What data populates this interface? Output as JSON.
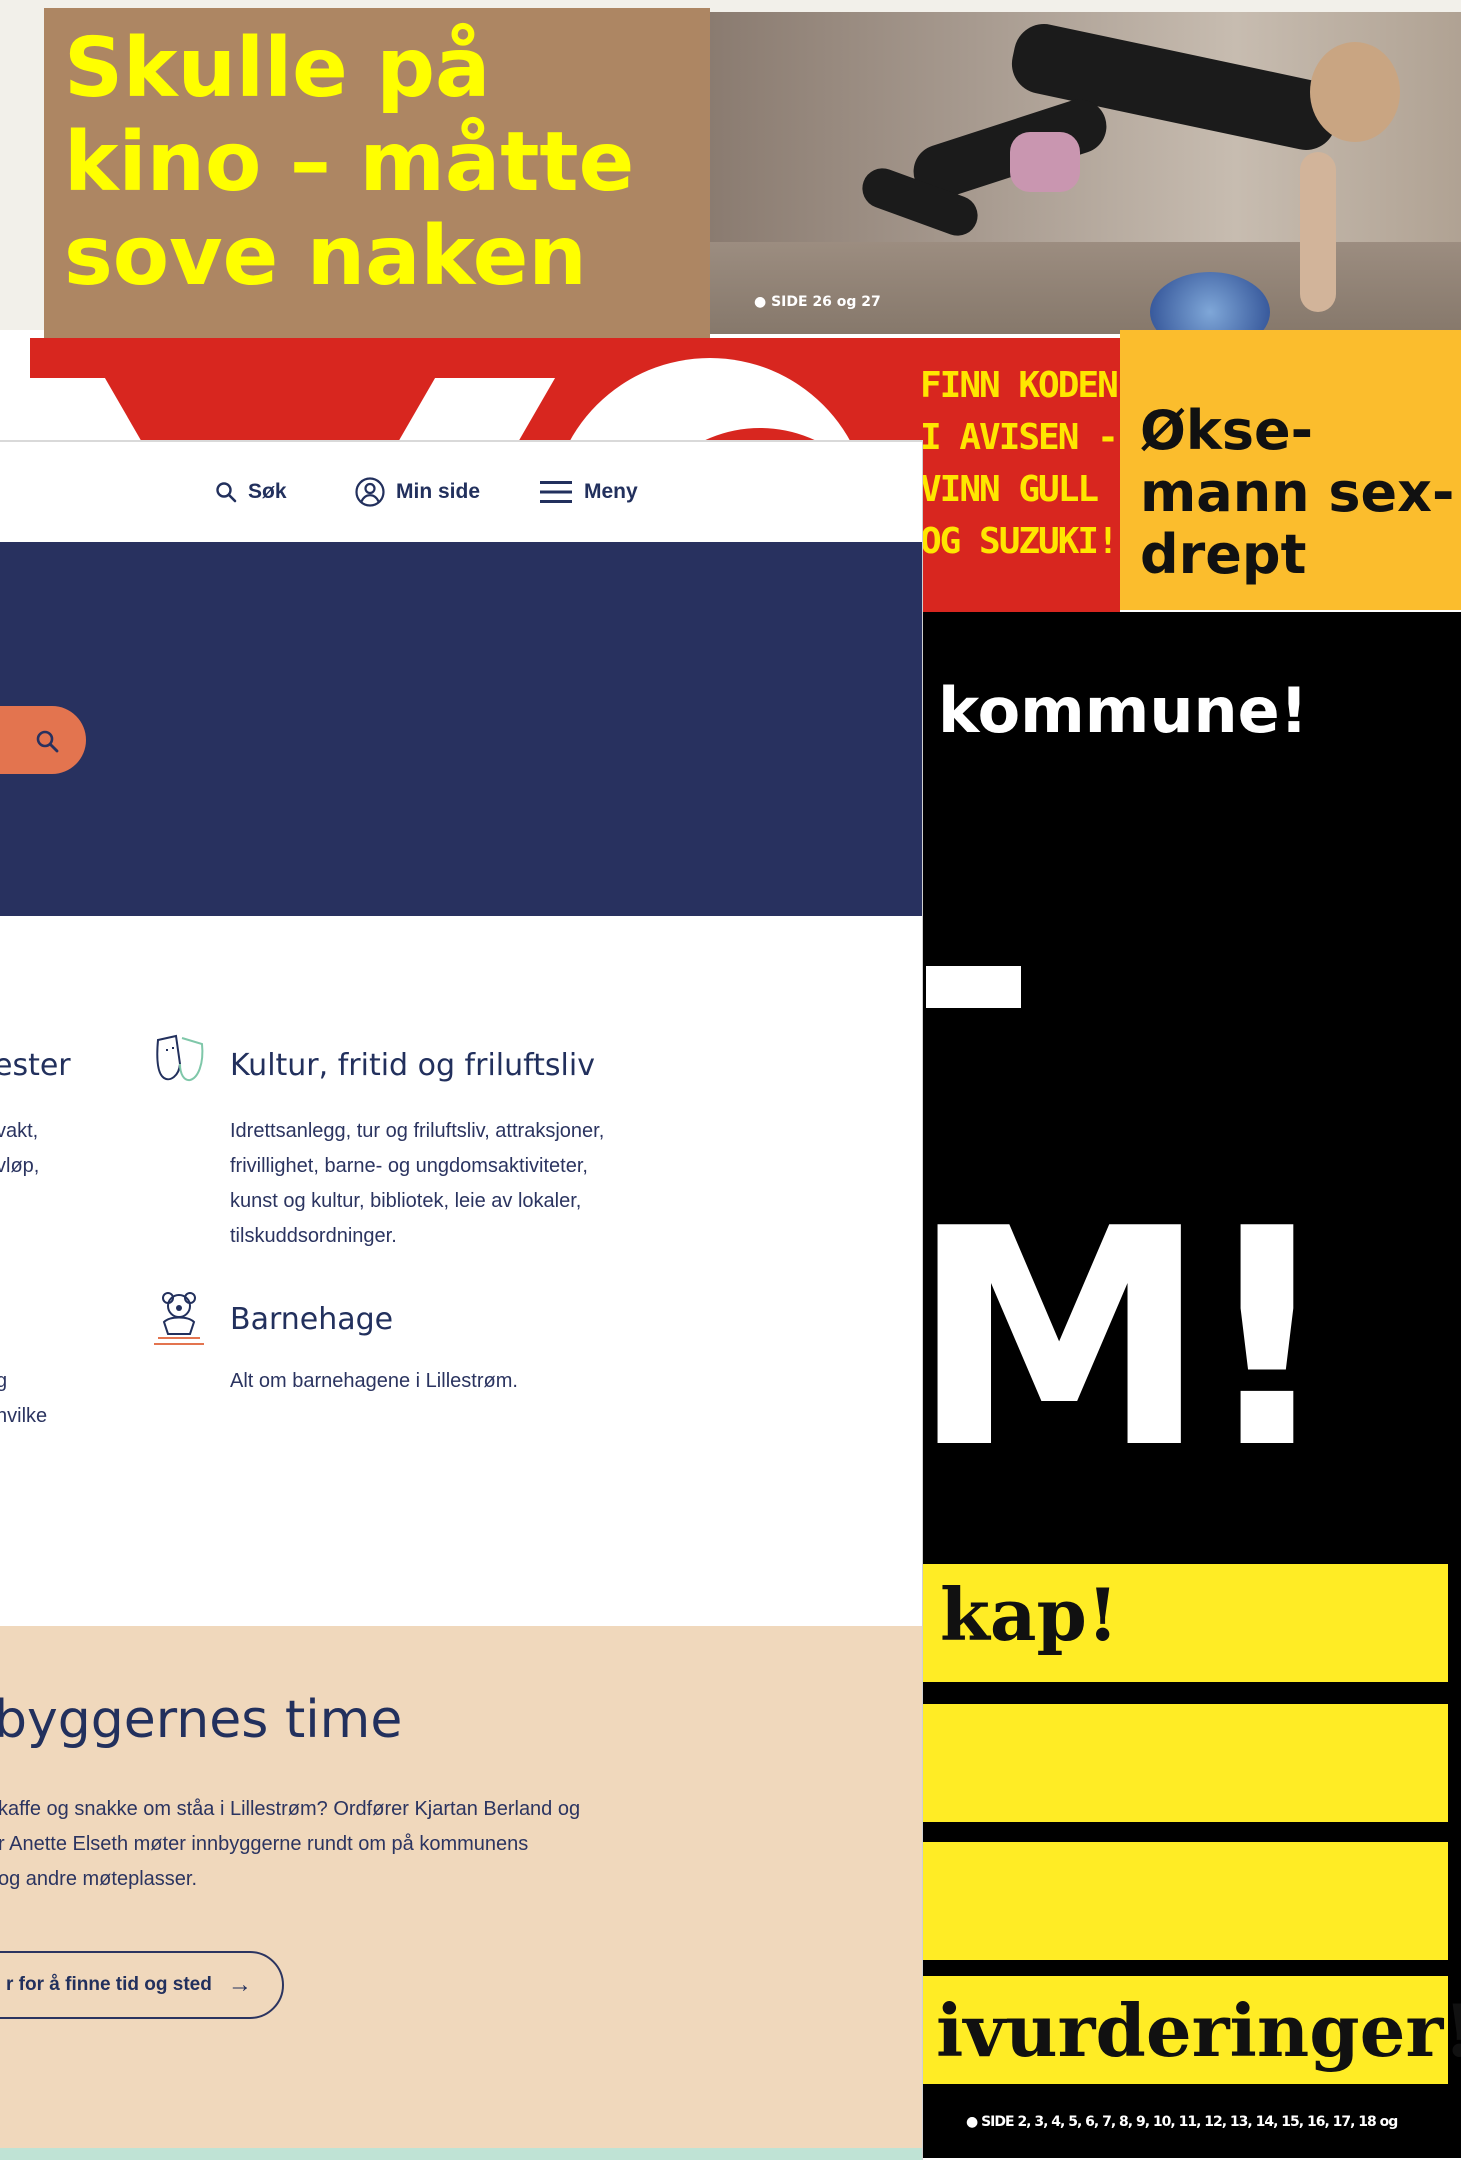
{
  "newspaper": {
    "skulle_lines": [
      "Skulle på",
      "kino – måtte",
      "sove naken"
    ],
    "photo_caption": "● SIDE 26 og 27",
    "finn_lines": [
      "FINN KODEN",
      "I AVISEN -",
      "VINN GULL",
      "OG SUZUKI!"
    ],
    "okse_lines": [
      "Økse-",
      "mann sex-",
      "drept"
    ],
    "kommune": "kommune!",
    "big_text": "M!",
    "kap": "kap!",
    "ivurderinger": "ivurderinger!",
    "sider": "● SIDE 2, 3, 4, 5, 6, 7, 8, 9, 10, 11, 12, 13, 14, 15, 16, 17, 18 og",
    "colors": {
      "skulle_bg": "#ad8663",
      "headline_yellow": "#ffff00",
      "vg_red": "#d8261f",
      "okse_bg": "#fbbd2d",
      "bar_yellow": "#ffec25"
    }
  },
  "site": {
    "nav": {
      "search": "Søk",
      "my_page": "Min side",
      "menu": "Meny"
    },
    "tiles": [
      {
        "title": "ester",
        "lines": [
          "vakt,",
          "vløp,"
        ]
      },
      {
        "title": "Kultur, fritid og friluftsliv",
        "lines": [
          "Idrettsanlegg, tur og friluftsliv, attraksjoner,",
          "frivillighet, barne- og ungdomsaktiviteter,",
          "kunst og kultur, bibliotek, leie av lokaler,",
          "tilskuddsordninger."
        ]
      },
      {
        "title": "Barnehage",
        "lines": [
          "Alt om barnehagene i Lillestrøm."
        ]
      },
      {
        "title": "",
        "lines": [
          "g",
          "nvilke"
        ]
      }
    ],
    "peach": {
      "title": "byggernes time",
      "lines": [
        "kaffe og snakke om ståa i Lillestrøm? Ordfører Kjartan Berland og",
        "r Anette Elseth møter innbyggerne rundt om på kommunens",
        "og andre møteplasser."
      ],
      "button": "r for å finne tid og sted",
      "button_arrow": "→"
    },
    "colors": {
      "navy": "#28315f",
      "orange": "#e3744f",
      "peach": "#f0d8bc",
      "mint": "#bfe3d5",
      "text": "#22305d"
    }
  }
}
